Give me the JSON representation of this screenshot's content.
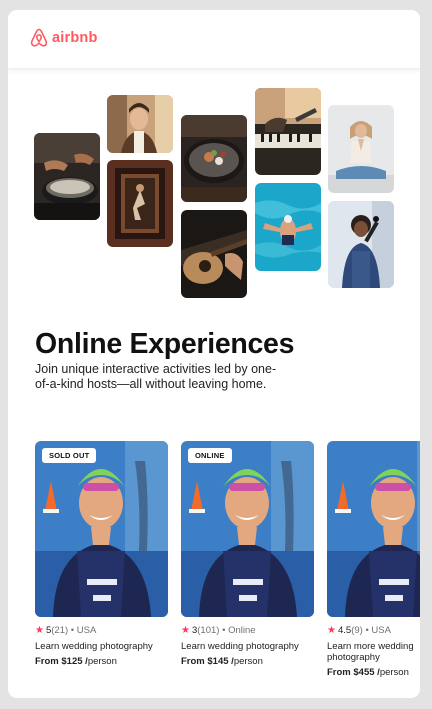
{
  "brand": {
    "name": "airbnb",
    "color": "#ff5a5f",
    "icon": "airbnb-logo-icon"
  },
  "gallery": [
    {
      "name": "cooking-pan-photo"
    },
    {
      "name": "chef-portrait-photo"
    },
    {
      "name": "doorway-dancer-photo"
    },
    {
      "name": "food-plate-photo"
    },
    {
      "name": "guitar-photo"
    },
    {
      "name": "piano-singer-photo"
    },
    {
      "name": "swimmer-photo"
    },
    {
      "name": "yoga-photo"
    },
    {
      "name": "mic-singer-photo"
    }
  ],
  "hero": {
    "title": "Online Experiences",
    "subtitle": "Join unique interactive activities led by one-of-a-kind hosts—all without leaving home."
  },
  "experiences": [
    {
      "badge": "SOLD OUT",
      "rating": "5",
      "reviews": "(21)",
      "location": "USA",
      "title": "Learn wedding photography",
      "price": "From $125",
      "unit": "person"
    },
    {
      "badge": "ONLINE",
      "rating": "3",
      "reviews": "(101)",
      "location": "Online",
      "title": "Learn wedding photography",
      "price": "From $145",
      "unit": "person"
    },
    {
      "badge": "",
      "rating": "4.5",
      "reviews": "(9)",
      "location": "USA",
      "title": "Learn more wedding photography",
      "price": "From $455",
      "unit": "person"
    }
  ],
  "sep": " • ",
  "slash": " /",
  "star_icon": "star-icon",
  "star_color": "#ff385c"
}
